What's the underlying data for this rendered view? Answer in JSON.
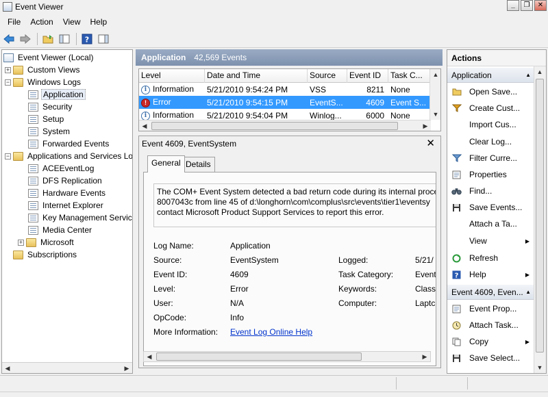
{
  "window": {
    "title": "Event Viewer"
  },
  "menu": [
    "File",
    "Action",
    "View",
    "Help"
  ],
  "toolbar": {
    "icons": [
      "back-arrow-icon",
      "forward-arrow-icon",
      "open-folder-icon",
      "show-hide-tree-icon",
      "help-icon",
      "show-hide-action-pane-icon"
    ]
  },
  "tree": {
    "root": "Event Viewer (Local)",
    "custom_views": "Custom Views",
    "windows_logs": "Windows Logs",
    "windows_logs_items": [
      "Application",
      "Security",
      "Setup",
      "System",
      "Forwarded Events"
    ],
    "apps_services": "Applications and Services Lo",
    "apps_services_items": [
      "ACEEventLog",
      "DFS Replication",
      "Hardware Events",
      "Internet Explorer",
      "Key Management Service",
      "Media Center"
    ],
    "microsoft": "Microsoft",
    "subscriptions": "Subscriptions"
  },
  "middle": {
    "title": "Application",
    "count": "42,569 Events"
  },
  "events_table": {
    "columns": [
      "Level",
      "Date and Time",
      "Source",
      "Event ID",
      "Task C..."
    ],
    "rows": [
      {
        "level": "Information",
        "datetime": "5/21/2010 9:54:24 PM",
        "source": "VSS",
        "event_id": "8211",
        "task": "None",
        "selected": false
      },
      {
        "level": "Error",
        "datetime": "5/21/2010 9:54:15 PM",
        "source": "EventS...",
        "event_id": "4609",
        "task": "Event S...",
        "selected": true
      },
      {
        "level": "Information",
        "datetime": "5/21/2010 9:54:04 PM",
        "source": "Winlog...",
        "event_id": "6000",
        "task": "None",
        "selected": false
      }
    ]
  },
  "detail": {
    "title": "Event 4609, EventSystem",
    "tabs": [
      "General",
      "Details"
    ],
    "description": [
      "The COM+ Event System detected a bad return code during its internal proce",
      "8007043c from line 45 of d:\\longhorn\\com\\complus\\src\\events\\tier1\\eventsy",
      "contact Microsoft Product Support Services to report this error."
    ],
    "props_left": [
      {
        "label": "Log Name:",
        "value": "Application"
      },
      {
        "label": "Source:",
        "value": "EventSystem"
      },
      {
        "label": "Event ID:",
        "value": "4609"
      },
      {
        "label": "Level:",
        "value": "Error"
      },
      {
        "label": "User:",
        "value": "N/A"
      },
      {
        "label": "OpCode:",
        "value": "Info"
      },
      {
        "label": "More Information:",
        "value": "Event Log Online Help"
      }
    ],
    "props_right": [
      {
        "label": "Logged:",
        "value": "5/21/"
      },
      {
        "label": "Task Category:",
        "value": "Event"
      },
      {
        "label": "Keywords:",
        "value": "Class"
      },
      {
        "label": "Computer:",
        "value": "Laptc"
      }
    ]
  },
  "actions": {
    "title": "Actions",
    "section1": "Application",
    "section1_items": [
      {
        "label": "Open Save...",
        "icon": "open-folder-icon",
        "submenu": false
      },
      {
        "label": "Create Cust...",
        "icon": "filter-icon",
        "submenu": false
      },
      {
        "label": "Import Cus...",
        "icon": "",
        "submenu": false
      },
      {
        "label": "Clear Log...",
        "icon": "",
        "submenu": false
      },
      {
        "label": "Filter Curre...",
        "icon": "filter-icon",
        "submenu": false
      },
      {
        "label": "Properties",
        "icon": "properties-icon",
        "submenu": false
      },
      {
        "label": "Find...",
        "icon": "binoculars-icon",
        "submenu": false
      },
      {
        "label": "Save Events...",
        "icon": "save-icon",
        "submenu": false
      },
      {
        "label": "Attach a Ta...",
        "icon": "",
        "submenu": false
      },
      {
        "label": "View",
        "icon": "",
        "submenu": true
      },
      {
        "label": "Refresh",
        "icon": "refresh-icon",
        "submenu": false
      },
      {
        "label": "Help",
        "icon": "help-icon",
        "submenu": true
      }
    ],
    "section2": "Event 4609, Even...",
    "section2_items": [
      {
        "label": "Event Prop...",
        "icon": "properties-icon",
        "submenu": false
      },
      {
        "label": "Attach Task...",
        "icon": "task-icon",
        "submenu": false
      },
      {
        "label": "Copy",
        "icon": "copy-icon",
        "submenu": true
      },
      {
        "label": "Save Select...",
        "icon": "save-icon",
        "submenu": false
      }
    ]
  }
}
